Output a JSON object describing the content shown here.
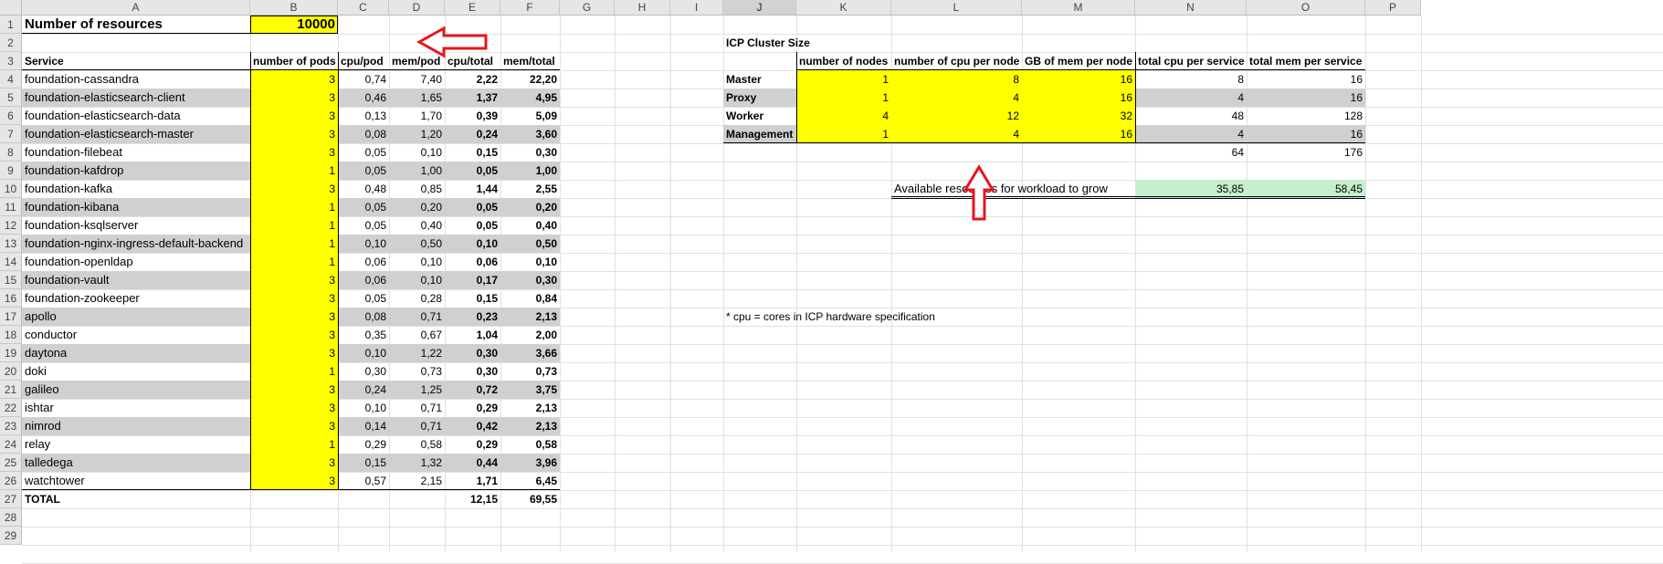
{
  "columns": [
    "A",
    "B",
    "C",
    "D",
    "E",
    "F",
    "G",
    "H",
    "I",
    "J",
    "K",
    "L",
    "M",
    "N",
    "O",
    "P"
  ],
  "selected_column": "J",
  "rows": [
    "1",
    "2",
    "3",
    "4",
    "5",
    "6",
    "7",
    "8",
    "9",
    "10",
    "11",
    "12",
    "13",
    "14",
    "15",
    "16",
    "17",
    "18",
    "19",
    "20",
    "21",
    "22",
    "23",
    "24",
    "25",
    "26",
    "27",
    "28",
    "29"
  ],
  "header": {
    "label": "Number of resources",
    "value": "10000"
  },
  "table": {
    "headers": [
      "Service",
      "number of pods",
      "cpu/pod",
      "mem/pod",
      "cpu/total",
      "mem/total"
    ],
    "rows": [
      [
        "foundation-cassandra",
        "3",
        "0,74",
        "7,40",
        "2,22",
        "22,20"
      ],
      [
        "foundation-elasticsearch-client",
        "3",
        "0,46",
        "1,65",
        "1,37",
        "4,95"
      ],
      [
        "foundation-elasticsearch-data",
        "3",
        "0,13",
        "1,70",
        "0,39",
        "5,09"
      ],
      [
        "foundation-elasticsearch-master",
        "3",
        "0,08",
        "1,20",
        "0,24",
        "3,60"
      ],
      [
        "foundation-filebeat",
        "3",
        "0,05",
        "0,10",
        "0,15",
        "0,30"
      ],
      [
        "foundation-kafdrop",
        "1",
        "0,05",
        "1,00",
        "0,05",
        "1,00"
      ],
      [
        "foundation-kafka",
        "3",
        "0,48",
        "0,85",
        "1,44",
        "2,55"
      ],
      [
        "foundation-kibana",
        "1",
        "0,05",
        "0,20",
        "0,05",
        "0,20"
      ],
      [
        "foundation-ksqlserver",
        "1",
        "0,05",
        "0,40",
        "0,05",
        "0,40"
      ],
      [
        "foundation-nginx-ingress-default-backend",
        "1",
        "0,10",
        "0,50",
        "0,10",
        "0,50"
      ],
      [
        "foundation-openldap",
        "1",
        "0,06",
        "0,10",
        "0,06",
        "0,10"
      ],
      [
        "foundation-vault",
        "3",
        "0,06",
        "0,10",
        "0,17",
        "0,30"
      ],
      [
        "foundation-zookeeper",
        "3",
        "0,05",
        "0,28",
        "0,15",
        "0,84"
      ],
      [
        "apollo",
        "3",
        "0,08",
        "0,71",
        "0,23",
        "2,13"
      ],
      [
        "conductor",
        "3",
        "0,35",
        "0,67",
        "1,04",
        "2,00"
      ],
      [
        "daytona",
        "3",
        "0,10",
        "1,22",
        "0,30",
        "3,66"
      ],
      [
        "doki",
        "1",
        "0,30",
        "0,73",
        "0,30",
        "0,73"
      ],
      [
        "galileo",
        "3",
        "0,24",
        "1,25",
        "0,72",
        "3,75"
      ],
      [
        "ishtar",
        "3",
        "0,10",
        "0,71",
        "0,29",
        "2,13"
      ],
      [
        "nimrod",
        "3",
        "0,14",
        "0,71",
        "0,42",
        "2,13"
      ],
      [
        "relay",
        "1",
        "0,29",
        "0,58",
        "0,29",
        "0,58"
      ],
      [
        "talledega",
        "3",
        "0,15",
        "1,32",
        "0,44",
        "3,96"
      ],
      [
        "watchtower",
        "3",
        "0,57",
        "2,15",
        "1,71",
        "6,45"
      ]
    ],
    "total_label": "TOTAL",
    "total_cpu": "12,15",
    "total_mem": "69,55"
  },
  "cluster": {
    "title": "ICP Cluster Size",
    "headers": [
      "number of nodes",
      "number of cpu per node *",
      "GB of mem per node",
      "total cpu per service",
      "total mem per service"
    ],
    "rows": [
      [
        "Master",
        "1",
        "8",
        "16",
        "8",
        "16"
      ],
      [
        "Proxy",
        "1",
        "4",
        "16",
        "4",
        "16"
      ],
      [
        "Worker",
        "4",
        "12",
        "32",
        "48",
        "128"
      ],
      [
        "Management",
        "1",
        "4",
        "16",
        "4",
        "16"
      ]
    ],
    "total_cpu": "64",
    "total_mem": "176",
    "available_label": "Available resources for workload to grow",
    "available_cpu": "35,85",
    "available_mem": "58,45",
    "footnote": "* cpu = cores in ICP hardware specification"
  },
  "colors": {
    "highlight": "#ffff00",
    "available": "#c6efce",
    "band": "#d0d0d0",
    "arrow": "#e8141c"
  }
}
